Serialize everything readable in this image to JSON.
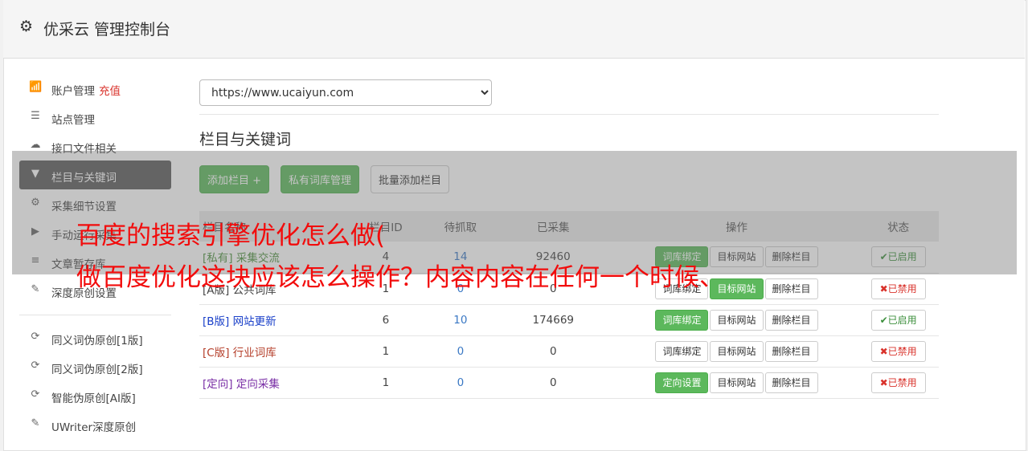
{
  "header": {
    "title": "优采云 管理控制台",
    "icon": "gear-icon"
  },
  "sidebar": {
    "items": [
      {
        "label": "账户管理",
        "extra": "充值",
        "icon": "bar-chart-icon"
      },
      {
        "label": "站点管理",
        "icon": "server-icon"
      },
      {
        "label": "接口文件相关",
        "icon": "cloud-upload-icon"
      },
      {
        "label": "栏目与关键词",
        "icon": "filter-icon",
        "active": true
      },
      {
        "label": "采集细节设置",
        "icon": "gears-icon"
      },
      {
        "label": "手动运行采集",
        "icon": "play-icon"
      },
      {
        "label": "文章暂存库",
        "icon": "database-icon"
      },
      {
        "label": "深度原创设置",
        "icon": "edit-icon"
      }
    ],
    "items2": [
      {
        "label": "同义词伪原创[1版]",
        "icon": "refresh-icon"
      },
      {
        "label": "同义词伪原创[2版]",
        "icon": "refresh-icon"
      },
      {
        "label": "智能伪原创[AI版]",
        "icon": "refresh-icon"
      },
      {
        "label": "UWriter深度原创",
        "icon": "edit-icon"
      }
    ]
  },
  "main": {
    "site_select": "https://www.ucaiyun.com",
    "section_title": "栏目与关键词",
    "buttons": {
      "add_column": "添加栏目 +",
      "private_lib": "私有词库管理",
      "batch_add": "批量添加栏目"
    },
    "table": {
      "headers": [
        "栏目名称",
        "栏目ID",
        "待抓取",
        "已采集",
        "操作",
        "状态"
      ],
      "rows": [
        {
          "tag": "[私有]",
          "name": "采集交流",
          "id": "4",
          "pending": "14",
          "collected": "92460",
          "op1": "词库绑定",
          "op2": "目标网站",
          "op3": "删除栏目",
          "status": "已启用"
        },
        {
          "tag": "[A版]",
          "name": "公共词库",
          "id": "1",
          "pending": "0",
          "collected": "0",
          "op1": "词库绑定",
          "op2": "目标网站",
          "op3": "删除栏目",
          "status": "已禁用"
        },
        {
          "tag": "[B版]",
          "name": "网站更新",
          "id": "6",
          "pending": "10",
          "collected": "174669",
          "op1": "词库绑定",
          "op2": "目标网站",
          "op3": "删除栏目",
          "status": "已启用"
        },
        {
          "tag": "[C版]",
          "name": "行业词库",
          "id": "1",
          "pending": "0",
          "collected": "0",
          "op1": "词库绑定",
          "op2": "目标网站",
          "op3": "删除栏目",
          "status": "已禁用"
        },
        {
          "tag": "[定向]",
          "name": "定向采集",
          "id": "1",
          "pending": "0",
          "collected": "0",
          "op1": "定向设置",
          "op2": "目标网站",
          "op3": "删除栏目",
          "status": "已禁用"
        }
      ]
    }
  },
  "overlay": {
    "line1": "百度的搜索引擎优化怎么做(",
    "line2": "做百度优化这块应该怎么操作？内容内容在任何一个时候、"
  },
  "colors": {
    "green": "#5cb85c",
    "active_nav": "#5a5a5a",
    "overlay_text": "#f20c0c",
    "disabled_red": "#d9322b"
  }
}
